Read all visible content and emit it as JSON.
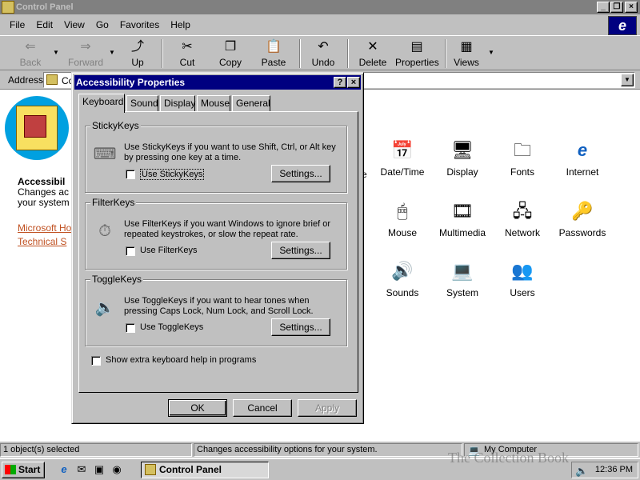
{
  "window": {
    "title": "Control Panel"
  },
  "menu": [
    "File",
    "Edit",
    "View",
    "Go",
    "Favorites",
    "Help"
  ],
  "toolbar": {
    "back": "Back",
    "forward": "Forward",
    "up": "Up",
    "cut": "Cut",
    "copy": "Copy",
    "paste": "Paste",
    "undo": "Undo",
    "delete": "Delete",
    "properties": "Properties",
    "views": "Views"
  },
  "address": {
    "label": "Address",
    "value": "Co"
  },
  "info": {
    "title": "Accessibil",
    "desc": "Changes ac your system",
    "link1": "Microsoft Ho",
    "link2": "Technical S"
  },
  "stray_label": "e",
  "icons": {
    "datetime": "Date/Time",
    "display": "Display",
    "fonts": "Fonts",
    "internet": "Internet",
    "mouse": "Mouse",
    "multimedia": "Multimedia",
    "network": "Network",
    "passwords": "Passwords",
    "sounds": "Sounds",
    "system": "System",
    "users": "Users"
  },
  "statusbar": {
    "selected": "1 object(s) selected",
    "description": "Changes accessibility options for your system.",
    "zone": "My Computer"
  },
  "taskbar": {
    "start": "Start",
    "task": "Control Panel",
    "clock": "12:36 PM"
  },
  "watermark": "The Collection Book",
  "dialog": {
    "title": "Accessibility Properties",
    "help_btn": "?",
    "close_btn": "×",
    "tabs": [
      "Keyboard",
      "Sound",
      "Display",
      "Mouse",
      "General"
    ],
    "stickykeys": {
      "label": "StickyKeys",
      "desc": "Use StickyKeys if you want to use Shift, Ctrl, or Alt key by pressing one key at a time.",
      "checkbox": "Use StickyKeys",
      "settings": "Settings..."
    },
    "filterkeys": {
      "label": "FilterKeys",
      "desc": "Use FilterKeys if you want Windows to ignore brief or repeated keystrokes, or slow the repeat rate.",
      "checkbox": "Use FilterKeys",
      "settings": "Settings..."
    },
    "togglekeys": {
      "label": "ToggleKeys",
      "desc": "Use ToggleKeys if you want to hear tones when pressing Caps Lock, Num Lock, and Scroll Lock.",
      "checkbox": "Use ToggleKeys",
      "settings": "Settings..."
    },
    "extra_help": "Show extra keyboard help in programs",
    "ok": "OK",
    "cancel": "Cancel",
    "apply": "Apply"
  }
}
